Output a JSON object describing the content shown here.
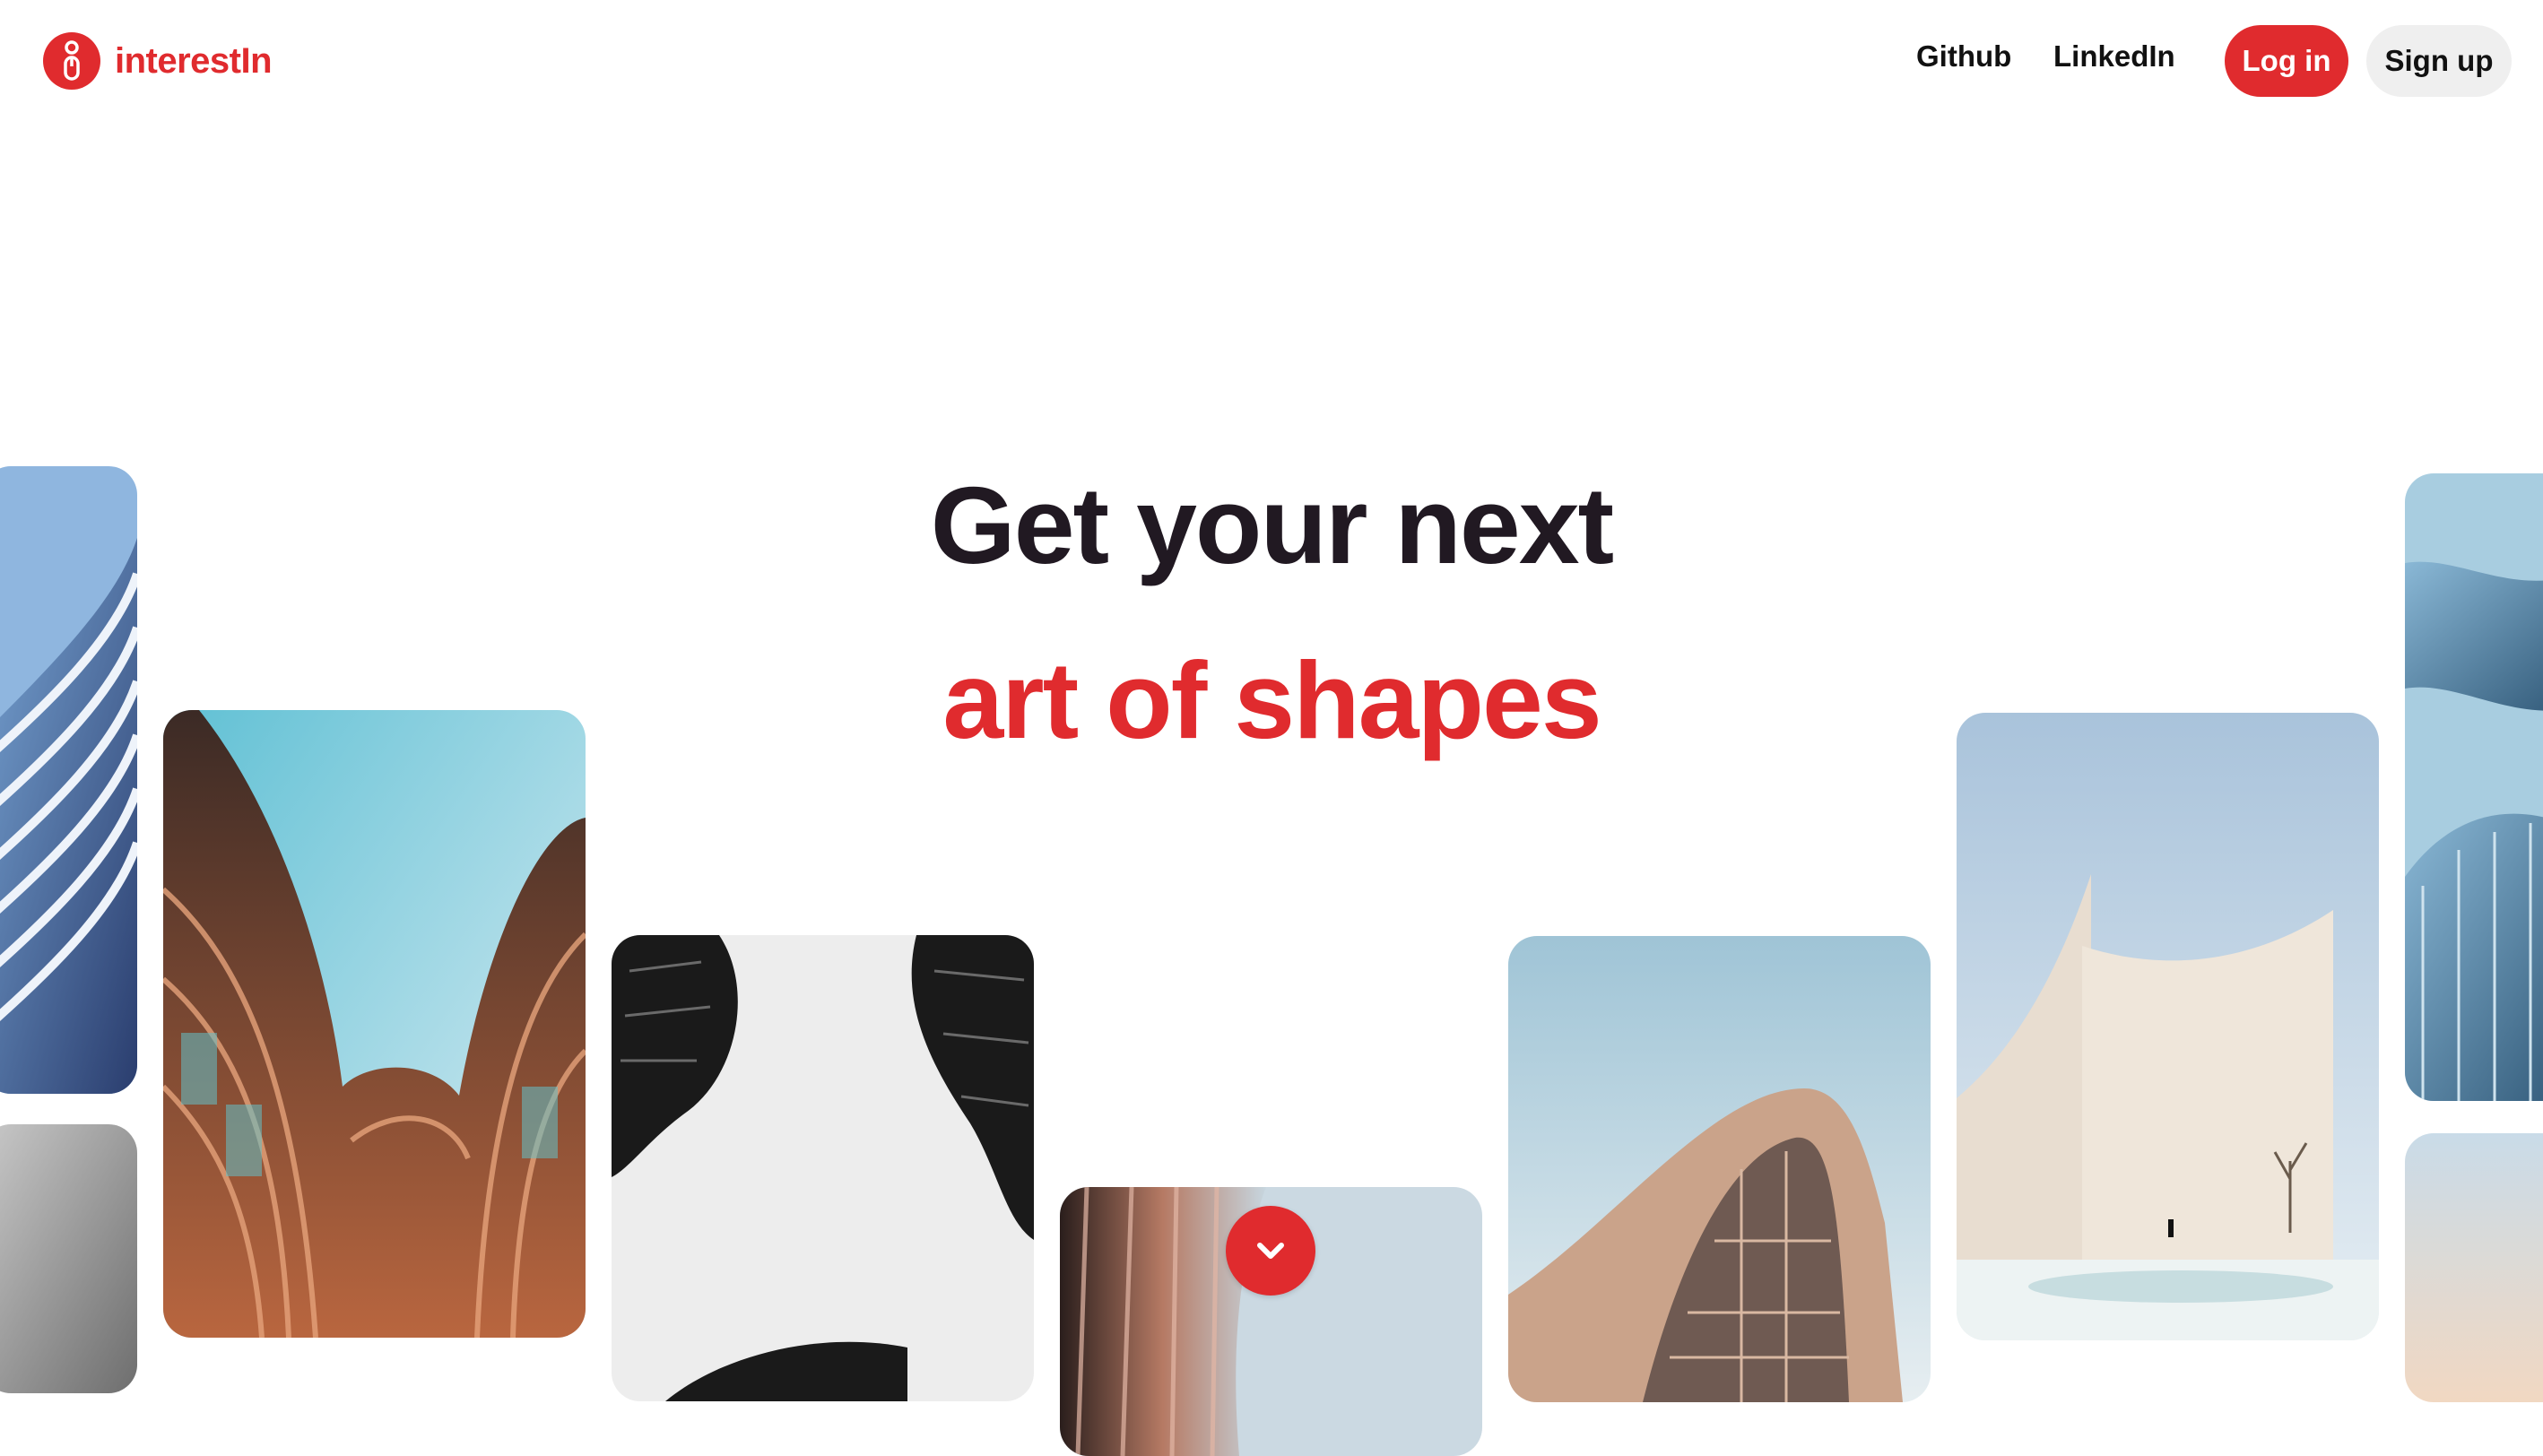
{
  "header": {
    "brand": "interestIn",
    "nav": {
      "github": "Github",
      "linkedin": "LinkedIn"
    },
    "login_label": "Log in",
    "signup_label": "Sign up"
  },
  "hero": {
    "line1": "Get your next",
    "line2": "art of shapes"
  },
  "colors": {
    "brand_red": "#e02b2e",
    "text_dark": "#211922",
    "signup_bg": "#efefef"
  },
  "icons": {
    "logo": "interestin-logo-icon",
    "scroll": "chevron-down-icon"
  }
}
